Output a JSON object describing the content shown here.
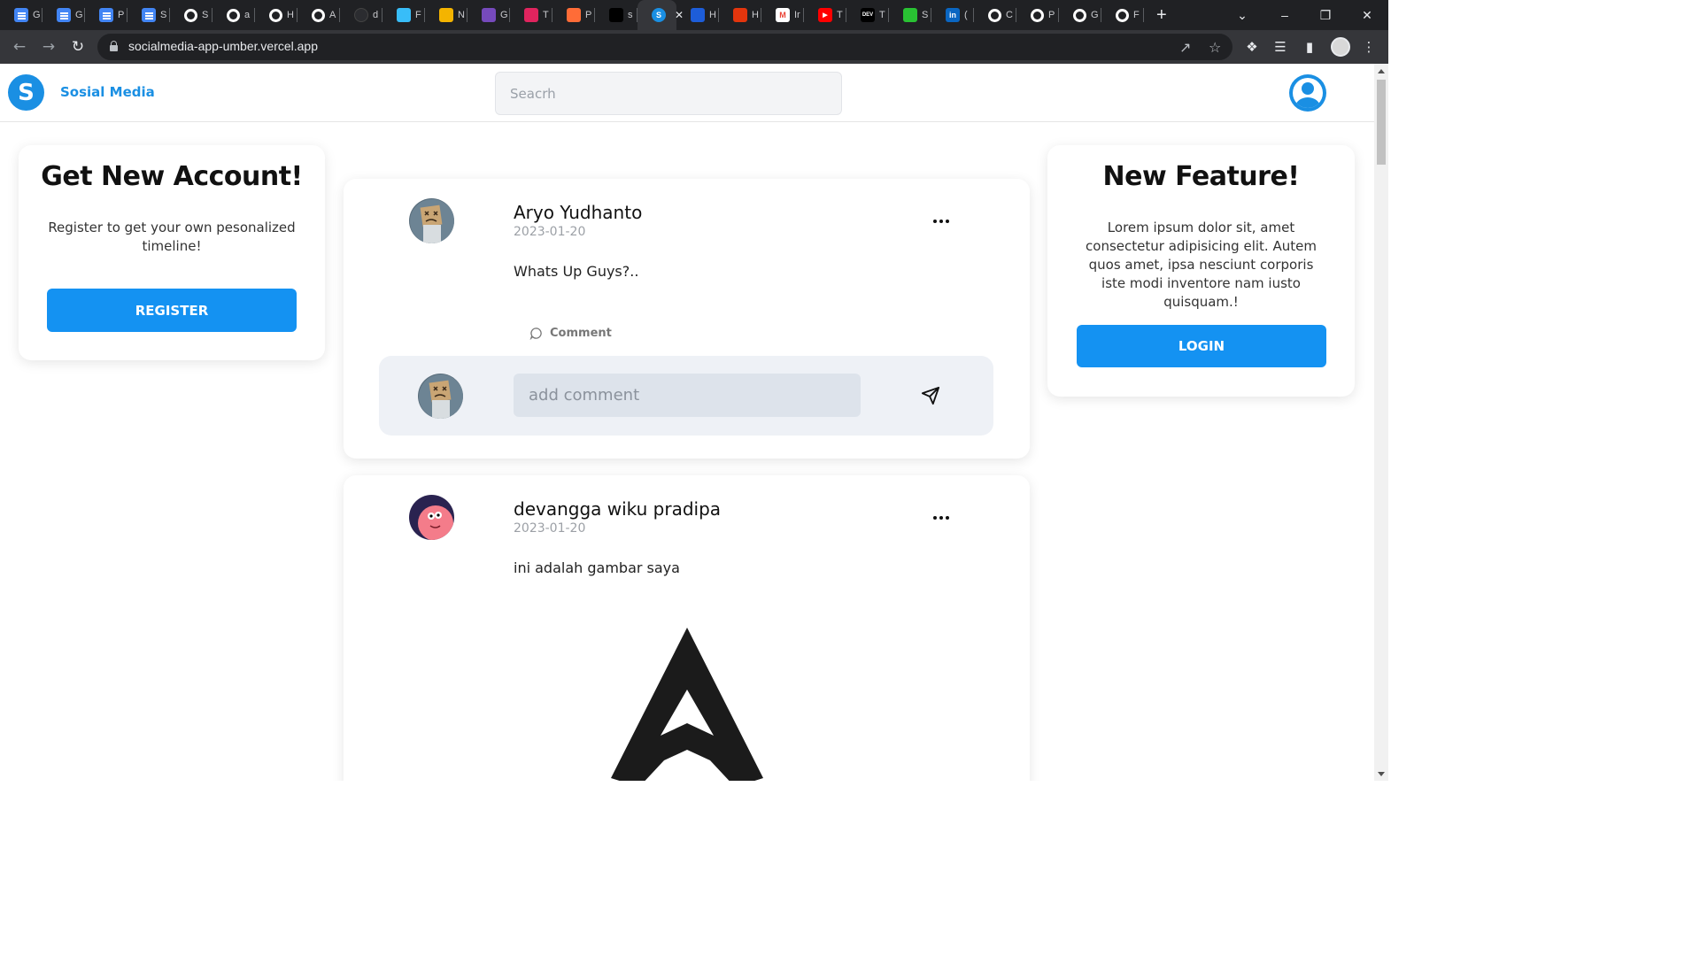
{
  "browser": {
    "tabs": [
      {
        "icon": "google-docs-icon",
        "title": "G",
        "color": "#4285f4"
      },
      {
        "icon": "google-docs-icon",
        "title": "G",
        "color": "#4285f4"
      },
      {
        "icon": "google-docs-icon",
        "title": "P",
        "color": "#4285f4"
      },
      {
        "icon": "google-docs-icon",
        "title": "S",
        "color": "#4285f4"
      },
      {
        "icon": "github-icon",
        "title": "S"
      },
      {
        "icon": "github-icon",
        "title": "a"
      },
      {
        "icon": "github-icon",
        "title": "H"
      },
      {
        "icon": "github-icon",
        "title": "A"
      },
      {
        "icon": "dark-circle-icon",
        "title": "d",
        "color": "#2b2c30"
      },
      {
        "icon": "tailwind-icon",
        "title": "F",
        "color": "#38bdf8"
      },
      {
        "icon": "sunflower-icon",
        "title": "N",
        "color": "#f4b400"
      },
      {
        "icon": "redux-icon",
        "title": "G",
        "color": "#764abc"
      },
      {
        "icon": "mountain-icon",
        "title": "T",
        "color": "#e0245e"
      },
      {
        "icon": "postman-icon",
        "title": "P",
        "color": "#ff6c37"
      },
      {
        "icon": "vercel-icon",
        "title": "s",
        "color": "#000000"
      },
      {
        "icon": "skype-icon",
        "title": "",
        "color": "#1a8fe3",
        "active": true
      },
      {
        "icon": "check-icon",
        "title": "H",
        "color": "#1d5dd9"
      },
      {
        "icon": "pokeball-icon",
        "title": "H",
        "color": "#e3350d"
      },
      {
        "icon": "gmail-icon",
        "title": "Ir",
        "color": "#ea4335"
      },
      {
        "icon": "youtube-icon",
        "title": "T",
        "color": "#ff0000"
      },
      {
        "icon": "dev-icon",
        "title": "T",
        "color": "#000000"
      },
      {
        "icon": "green-bracket-icon",
        "title": "S",
        "color": "#29c233"
      },
      {
        "icon": "linkedin-icon",
        "title": "(",
        "color": "#0a66c2"
      },
      {
        "icon": "github-icon",
        "title": "C"
      },
      {
        "icon": "github-icon",
        "title": "P"
      },
      {
        "icon": "github-icon",
        "title": "G"
      },
      {
        "icon": "github-icon",
        "title": "F"
      }
    ],
    "new_tab": "+",
    "url": "socialmedia-app-umber.vercel.app"
  },
  "header": {
    "logo_letter": "S",
    "brand": "Sosial Media",
    "search_placeholder": "Seacrh"
  },
  "left_card": {
    "title": "Get New Account!",
    "description": "Register to get your own pesonalized timeline!",
    "button": "REGISTER"
  },
  "right_card": {
    "title": "New Feature!",
    "description": "Lorem ipsum dolor sit, amet consectetur adipisicing elit. Autem quos amet, ipsa nesciunt corporis iste modi inventore nam iusto quisquam.!",
    "button": "LOGIN"
  },
  "posts": [
    {
      "author": "Aryo Yudhanto",
      "date": "2023-01-20",
      "text": "Whats Up Guys?..",
      "comment_label": "Comment",
      "comment_placeholder": "add comment"
    },
    {
      "author": "devangga wiku pradipa",
      "date": "2023-01-20",
      "text": "ini adalah gambar saya",
      "image_icon": "apex-legends-logo"
    }
  ],
  "colors": {
    "accent": "#1a8fe3",
    "button": "#1492f2"
  }
}
